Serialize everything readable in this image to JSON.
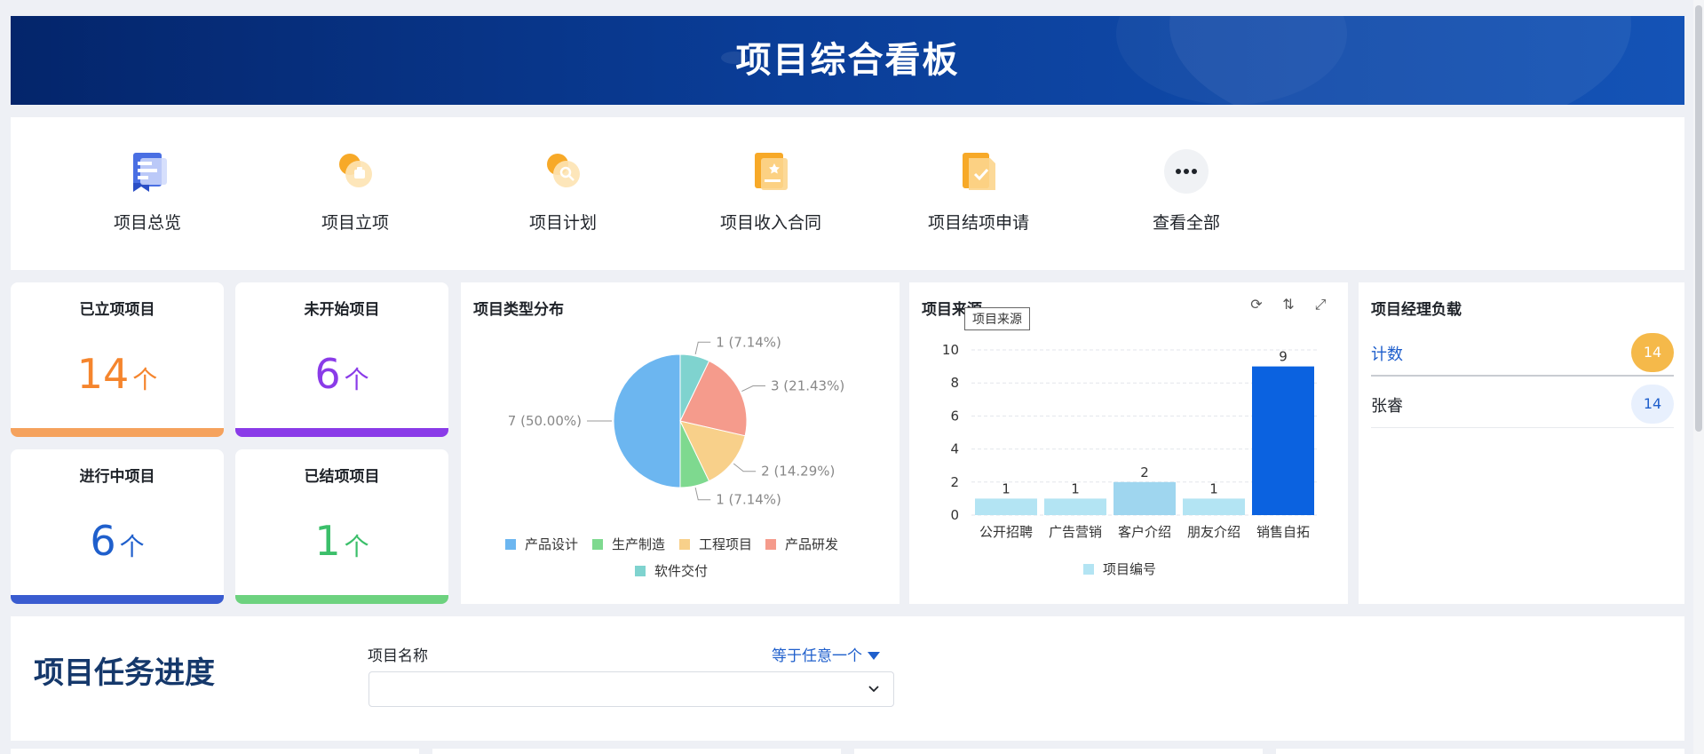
{
  "header": {
    "title": "项目综合看板"
  },
  "shortcuts": [
    {
      "label": "项目总览",
      "icon": "ribbon-doc-icon"
    },
    {
      "label": "项目立项",
      "icon": "project-setup-icon"
    },
    {
      "label": "项目计划",
      "icon": "plan-search-icon"
    },
    {
      "label": "项目收入合同",
      "icon": "contract-icon"
    },
    {
      "label": "项目结项申请",
      "icon": "closing-check-icon"
    },
    {
      "label": "查看全部",
      "icon": "more-icon"
    }
  ],
  "stats": [
    {
      "title": "已立项项目",
      "value": "14",
      "unit": "个",
      "color": "#f5852d",
      "bar": "#f5a25d"
    },
    {
      "title": "未开始项目",
      "value": "6",
      "unit": "个",
      "color": "#8a3be8",
      "bar": "#8a3be8"
    },
    {
      "title": "进行中项目",
      "value": "6",
      "unit": "个",
      "color": "#1f5fcc",
      "bar": "#3a5cd0"
    },
    {
      "title": "已结项项目",
      "value": "1",
      "unit": "个",
      "color": "#3bbf6a",
      "bar": "#6dd27f"
    }
  ],
  "pie_panel": {
    "title": "项目类型分布"
  },
  "bar_panel": {
    "title": "项目来源",
    "tooltip": "项目来源"
  },
  "manager_panel": {
    "title": "项目经理负载",
    "rows": [
      {
        "name": "计数",
        "count": "14"
      },
      {
        "name": "张睿",
        "count": "14"
      }
    ]
  },
  "task": {
    "title": "项目任务进度",
    "filter_label": "项目名称",
    "filter_operator": "等于任意一个",
    "filter_value": ""
  },
  "chart_data": [
    {
      "type": "pie",
      "title": "项目类型分布",
      "slices": [
        {
          "label": "产品设计",
          "value": 7,
          "display": "7 (50.00%)",
          "color": "#6cb6f0"
        },
        {
          "label": "生产制造",
          "value": 1,
          "display": "1 (7.14%)",
          "color": "#7ed98f"
        },
        {
          "label": "工程项目",
          "value": 2,
          "display": "2 (14.29%)",
          "color": "#f8d08a"
        },
        {
          "label": "产品研发",
          "value": 3,
          "display": "3 (21.43%)",
          "color": "#f59b8c"
        },
        {
          "label": "软件交付",
          "value": 1,
          "display": "1 (7.14%)",
          "color": "#7fd3cf"
        }
      ],
      "legend": [
        "产品设计",
        "生产制造",
        "工程项目",
        "产品研发",
        "软件交付"
      ],
      "legend_position": "bottom"
    },
    {
      "type": "bar",
      "title": "项目来源",
      "categories": [
        "公开招聘",
        "广告营销",
        "客户介绍",
        "朋友介绍",
        "销售自拓"
      ],
      "series": [
        {
          "name": "项目编号",
          "values": [
            1,
            1,
            2,
            1,
            9
          ]
        }
      ],
      "bar_colors": [
        "#b3e4f3",
        "#b3e4f3",
        "#9fd6ef",
        "#b3e4f3",
        "#0b62e0"
      ],
      "legend_color": "#b3e4f3",
      "ylim": [
        0,
        10
      ],
      "yticks": [
        "0",
        "2",
        "4",
        "6",
        "8",
        "10"
      ],
      "grid": true,
      "legend_position": "bottom"
    }
  ]
}
